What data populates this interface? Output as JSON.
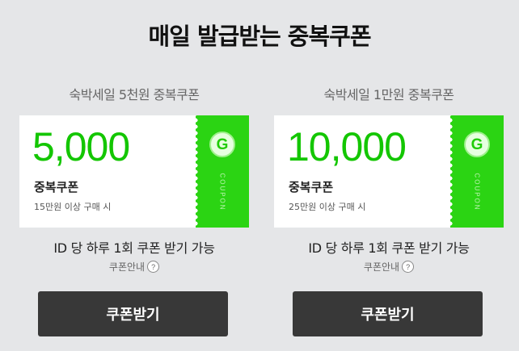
{
  "page": {
    "title": "매일 발급받는 중복쿠폰"
  },
  "colors": {
    "background": "#e5e6e8",
    "accent_green": "#13c600",
    "coupon_tab_green": "#2bd413",
    "button_dark": "#383838"
  },
  "coupons": [
    {
      "subtitle": "숙박세일 5천원 중복쿠폰",
      "amount": "5,000",
      "type": "중복쿠폰",
      "condition": "15만원 이상 구매 시",
      "badge_letter": "G",
      "tab_label": "COUPON",
      "limit_text": "ID 당 하루 1회 쿠폰 받기 가능",
      "guide_label": "쿠폰안내",
      "guide_icon": "?",
      "button_label": "쿠폰받기"
    },
    {
      "subtitle": "숙박세일 1만원 중복쿠폰",
      "amount": "10,000",
      "type": "중복쿠폰",
      "condition": "25만원 이상 구매 시",
      "badge_letter": "G",
      "tab_label": "COUPON",
      "limit_text": "ID 당 하루 1회 쿠폰 받기 가능",
      "guide_label": "쿠폰안내",
      "guide_icon": "?",
      "button_label": "쿠폰받기"
    }
  ]
}
